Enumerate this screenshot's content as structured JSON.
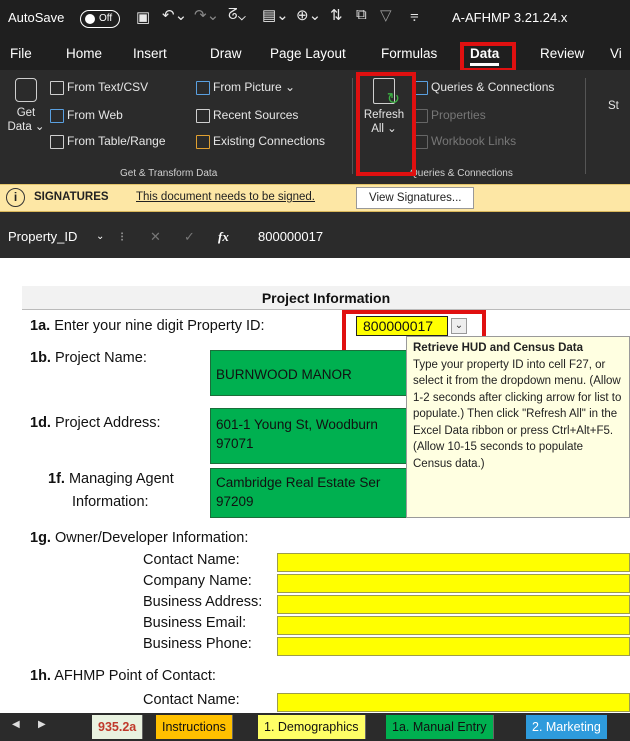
{
  "titlebar": {
    "autosave": "AutoSave",
    "autosave_state": "Off",
    "filename": "A-AFHMP 3.21.24.x"
  },
  "menu": [
    "File",
    "Home",
    "Insert",
    "Draw",
    "Page Layout",
    "Formulas",
    "Data",
    "Review",
    "Vi"
  ],
  "ribbon": {
    "get_data": "Get",
    "get_data2": "Data ⌄",
    "from_text": "From Text/CSV",
    "from_web": "From Web",
    "from_table": "From Table/Range",
    "from_picture": "From Picture ⌄",
    "recent_sources": "Recent Sources",
    "existing_connections": "Existing Connections",
    "group1": "Get & Transform Data",
    "refresh": "Refresh",
    "refresh2": "All ⌄",
    "queries": "Queries & Connections",
    "properties": "Properties",
    "workbook_links": "Workbook Links",
    "group2": "Queries & Connections",
    "st": "St"
  },
  "sigbar": {
    "title": "SIGNATURES",
    "message": "This document needs to be signed.",
    "button": "View Signatures..."
  },
  "formula": {
    "namebox": "Property_ID",
    "fx": "fx",
    "value": "800000017"
  },
  "sheet": {
    "header": "Project Information",
    "q1a_num": "1a.",
    "q1a": "Enter your nine digit Property ID:",
    "property_id": "800000017",
    "q1b_num": "1b.",
    "q1b": "Project Name:",
    "project_name": "BURNWOOD MANOR",
    "q1d_num": "1d.",
    "q1d": "Project Address:",
    "addr1": "601-1 Young St, Woodburn",
    "addr2": "97071",
    "q1f_num": "1f.",
    "q1f": "Managing Agent",
    "q1f2": "Information:",
    "agent1": "Cambridge Real Estate Ser",
    "agent2": "97209",
    "q1g_num": "1g.",
    "q1g": "Owner/Developer Information:",
    "contact_name": "Contact Name:",
    "company_name": "Company Name:",
    "business_address": "Business Address:",
    "business_email": "Business Email:",
    "business_phone": "Business Phone:",
    "q1h_num": "1h.",
    "q1h": "AFHMP Point of Contact:",
    "contact_name2": "Contact Name:"
  },
  "tooltip": {
    "title": "Retrieve HUD and Census Data",
    "body": "Type your property ID into cell F27, or select it from the dropdown menu. (Allow 1-2 seconds after clicking arrow for list to populate.) Then click \"Refresh All\" in the Excel Data ribbon or press Ctrl+Alt+F5. (Allow 10-15 seconds to populate Census data.)"
  },
  "tabs": [
    {
      "label": "935.2a",
      "color": "#e9f2e0",
      "text": "#c0392b"
    },
    {
      "label": "Instructions",
      "color": "#ffc000",
      "text": "#111"
    },
    {
      "label": "1. Demographics",
      "color": "#ffff66",
      "text": "#111"
    },
    {
      "label": "1a. Manual Entry",
      "color": "#00b050",
      "text": "#111"
    },
    {
      "label": "2. Marketing",
      "color": "#2e9bdc",
      "text": "#fff"
    }
  ],
  "colors": {
    "accent_red": "#e01010",
    "green": "#00b050",
    "yellow": "#ffff00"
  }
}
